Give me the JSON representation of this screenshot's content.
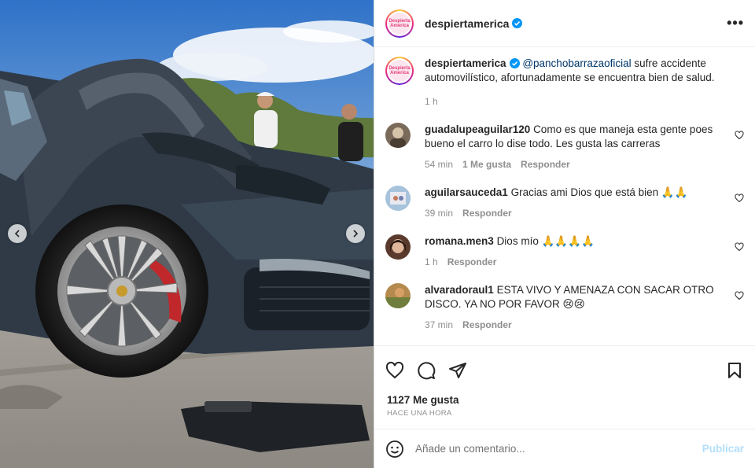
{
  "post": {
    "username": "despiertamerica",
    "avatar_text": "Despierta America",
    "more_icon": "more-horizontal-icon",
    "caption": {
      "username": "despiertamerica",
      "mention": "@panchobarrazaoficial",
      "text": " sufre accidente automovilístico, afortunadamente se encuentra bien de salud.",
      "time": "1 h"
    },
    "comments": [
      {
        "username": "guadalupeaguilar120",
        "text": "Como es que maneja esta gente poes bueno el carro lo dise todo. Les gusta las carreras",
        "time": "54 min",
        "likes": "1 Me gusta",
        "reply": "Responder",
        "avatar_color": "#7a6a5a"
      },
      {
        "username": "aguilarsauceda1",
        "text": "Gracias ami Dios que está bien 🙏🙏",
        "time": "39 min",
        "reply": "Responder",
        "avatar_color": "#a7c3dc"
      },
      {
        "username": "romana.men3",
        "text": "Dios mío 🙏🙏🙏🙏",
        "time": "1 h",
        "reply": "Responder",
        "avatar_color": "#5a3a2c"
      },
      {
        "username": "alvaradoraul1",
        "text": "ESTA VIVO Y AMENAZA CON SACAR OTRO DISCO. YA NO POR FAVOR 😢😢",
        "time": "37 min",
        "reply": "Responder",
        "avatar_color": "#b48a4e"
      }
    ],
    "likes_count": "1127 Me gusta",
    "posted": "HACE UNA HORA",
    "add_comment_placeholder": "Añade un comentario...",
    "publish_label": "Publicar"
  },
  "colors": {
    "verified": "#0095f6",
    "mention": "#00376b",
    "meta": "#8e8e8e",
    "publish": "#b2dffc"
  }
}
